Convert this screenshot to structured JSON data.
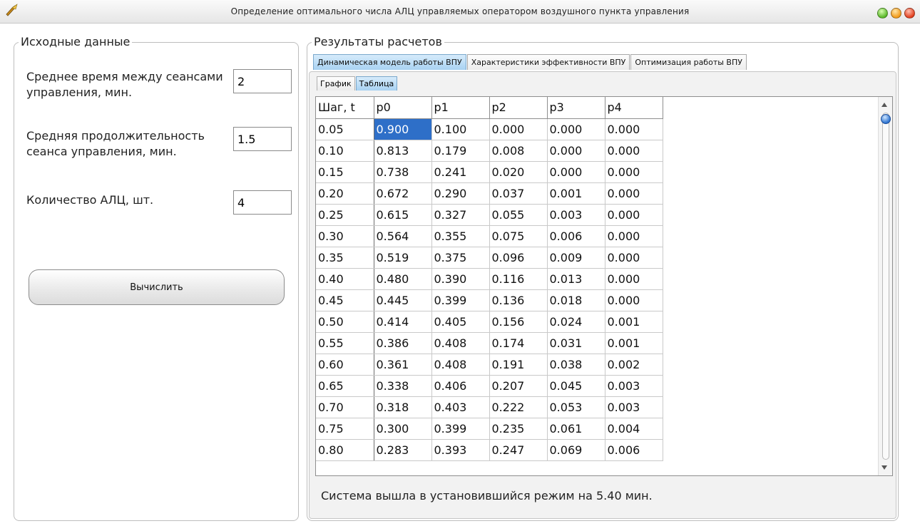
{
  "window": {
    "title": "Определение оптимального числа АЛЦ управляемых оператором воздушного пункта управления",
    "icons": [
      "app-icon",
      "maximize-icon",
      "minimize-icon",
      "close-icon"
    ],
    "button_colors": {
      "green": "#5bb82a",
      "orange": "#f29a1a",
      "red": "#e2401f"
    }
  },
  "input_panel": {
    "title": "Исходные данные",
    "fields": [
      {
        "label": "Среднее время между сеансами управления, мин.",
        "value": "2"
      },
      {
        "label": "Средняя продолжительность сеанса управления, мин.",
        "value": "1.5"
      },
      {
        "label": "Количество АЛЦ, шт.",
        "value": "4"
      }
    ],
    "compute_button": "Вычислить"
  },
  "results_panel": {
    "title": "Результаты расчетов",
    "tabs": [
      {
        "label": "Динамическая модель работы ВПУ",
        "active": true
      },
      {
        "label": "Характеристики эффективности ВПУ",
        "active": false
      },
      {
        "label": "Оптимизация работы ВПУ",
        "active": false
      }
    ],
    "subtabs": [
      {
        "label": "График",
        "active": false
      },
      {
        "label": "Таблица",
        "active": true
      }
    ],
    "table": {
      "columns": [
        "Шаг, t",
        "p0",
        "p1",
        "p2",
        "p3",
        "p4"
      ],
      "rows": [
        [
          "0.05",
          "0.900",
          "0.100",
          "0.000",
          "0.000",
          "0.000"
        ],
        [
          "0.10",
          "0.813",
          "0.179",
          "0.008",
          "0.000",
          "0.000"
        ],
        [
          "0.15",
          "0.738",
          "0.241",
          "0.020",
          "0.000",
          "0.000"
        ],
        [
          "0.20",
          "0.672",
          "0.290",
          "0.037",
          "0.001",
          "0.000"
        ],
        [
          "0.25",
          "0.615",
          "0.327",
          "0.055",
          "0.003",
          "0.000"
        ],
        [
          "0.30",
          "0.564",
          "0.355",
          "0.075",
          "0.006",
          "0.000"
        ],
        [
          "0.35",
          "0.519",
          "0.375",
          "0.096",
          "0.009",
          "0.000"
        ],
        [
          "0.40",
          "0.480",
          "0.390",
          "0.116",
          "0.013",
          "0.000"
        ],
        [
          "0.45",
          "0.445",
          "0.399",
          "0.136",
          "0.018",
          "0.000"
        ],
        [
          "0.50",
          "0.414",
          "0.405",
          "0.156",
          "0.024",
          "0.001"
        ],
        [
          "0.55",
          "0.386",
          "0.408",
          "0.174",
          "0.031",
          "0.001"
        ],
        [
          "0.60",
          "0.361",
          "0.408",
          "0.191",
          "0.038",
          "0.002"
        ],
        [
          "0.65",
          "0.338",
          "0.406",
          "0.207",
          "0.045",
          "0.003"
        ],
        [
          "0.70",
          "0.318",
          "0.403",
          "0.222",
          "0.053",
          "0.003"
        ],
        [
          "0.75",
          "0.300",
          "0.399",
          "0.235",
          "0.061",
          "0.004"
        ],
        [
          "0.80",
          "0.283",
          "0.393",
          "0.247",
          "0.069",
          "0.006"
        ]
      ],
      "selected_cell": {
        "row": 0,
        "col": 1
      },
      "selection_color": "#2e6fc8"
    },
    "status": "Система вышла в установившийся режим на 5.40 мин."
  }
}
